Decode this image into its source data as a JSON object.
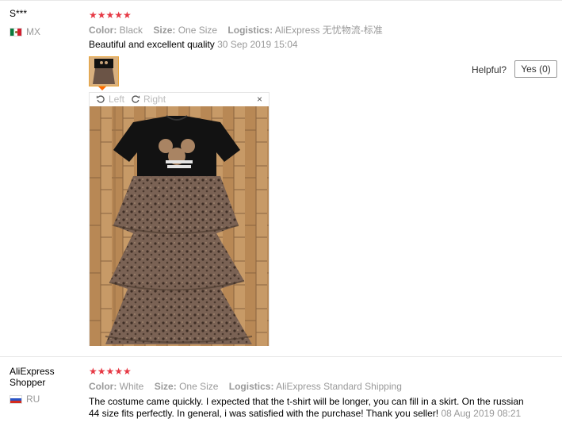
{
  "review1": {
    "user": "S***",
    "country": "MX",
    "stars": "★★★★★",
    "color_key": "Color:",
    "color_value": "Black",
    "size_key": "Size:",
    "size_value": "One Size",
    "logistics_key": "Logistics:",
    "logistics_value": "AliExpress 无忧物流-标准",
    "text": "Beautiful and excellent quality",
    "date": "30 Sep 2019 15:04",
    "helpful_label": "Helpful?",
    "yes_label": "Yes (0)",
    "viewer": {
      "rotate_left": "Left",
      "rotate_right": "Right",
      "close": "×"
    }
  },
  "review2": {
    "user": "AliExpress Shopper",
    "country": "RU",
    "stars": "★★★★★",
    "color_key": "Color:",
    "color_value": "White",
    "size_key": "Size:",
    "size_value": "One Size",
    "logistics_key": "Logistics:",
    "logistics_value": "AliExpress Standard Shipping",
    "text": "The costume came quickly. I expected that the t-shirt will be longer, you can fill in a skirt. On the russian 44 size fits perfectly. In general, i was satisfied with the purchase! Thank you seller!",
    "date": "08 Aug 2019 08:21"
  },
  "colors": {
    "star": "#e63945",
    "muted": "#999999",
    "thumb_border": "#e9a43a"
  }
}
